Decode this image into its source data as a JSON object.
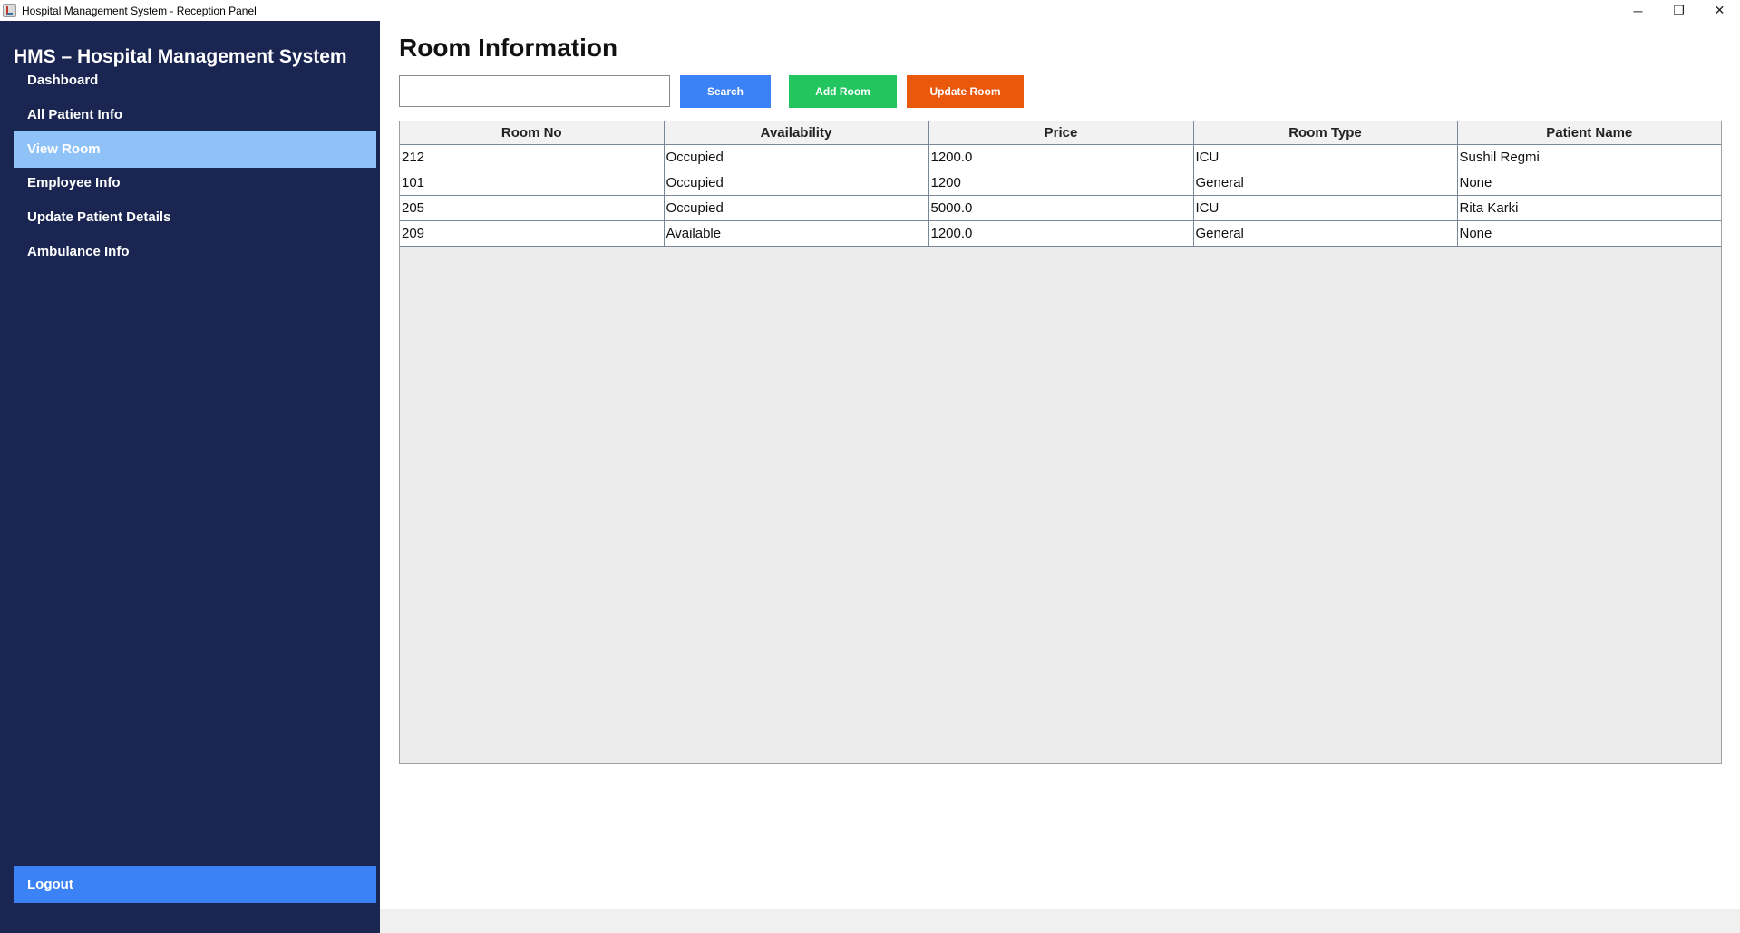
{
  "window": {
    "title": "Hospital Management System - Reception Panel",
    "minimize": "─",
    "restore": "❐",
    "close": "✕"
  },
  "sidebar": {
    "title": "HMS – Hospital Management System",
    "items": [
      {
        "label": "Dashboard",
        "active": false
      },
      {
        "label": "All Patient Info",
        "active": false
      },
      {
        "label": "View Room",
        "active": true
      },
      {
        "label": "Employee Info",
        "active": false
      },
      {
        "label": "Update Patient Details",
        "active": false
      },
      {
        "label": "Ambulance Info",
        "active": false
      }
    ],
    "logout": "Logout"
  },
  "main": {
    "title": "Room Information",
    "search": {
      "value": "",
      "placeholder": ""
    },
    "buttons": {
      "search": "Search",
      "add_room": "Add Room",
      "update_room": "Update Room"
    },
    "table": {
      "columns": [
        "Room No",
        "Availability",
        "Price",
        "Room Type",
        "Patient Name"
      ],
      "rows": [
        [
          "212",
          "Occupied",
          "1200.0",
          "ICU",
          "Sushil Regmi"
        ],
        [
          "101",
          "Occupied",
          "1200",
          "General",
          "None"
        ],
        [
          "205",
          "Occupied",
          "5000.0",
          "ICU",
          "Rita Karki"
        ],
        [
          "209",
          "Available",
          "1200.0",
          "General",
          "None"
        ]
      ]
    }
  },
  "colors": {
    "sidebar_bg": "#1a2552",
    "active_item": "#8fc2f7",
    "logout": "#3b82f6",
    "search_button": "#3b82f6",
    "add_button": "#22c55e",
    "update_button": "#ea580c"
  }
}
